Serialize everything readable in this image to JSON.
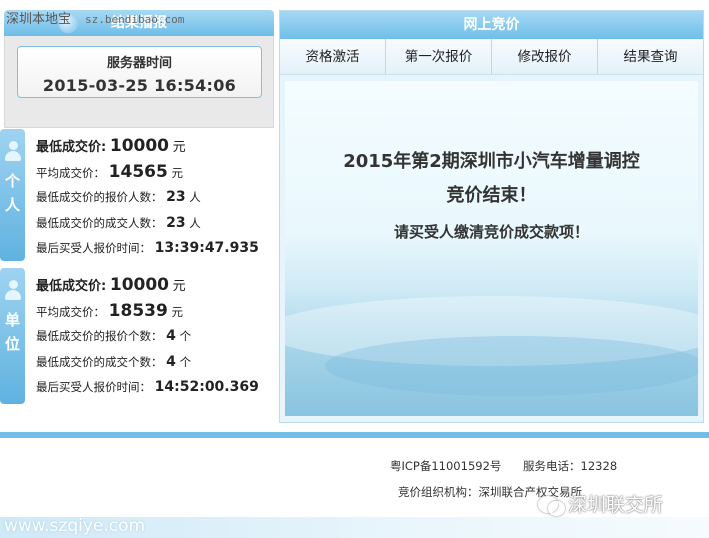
{
  "watermark": {
    "top_text": "深圳本地宝",
    "top_url": "sz.bendibao.com",
    "site": "www.szqiye.com",
    "brand": "深圳联交所"
  },
  "left": {
    "header": "结果播报",
    "server_time_label": "服务器时间",
    "server_time": "2015-03-25 16:54:06",
    "personal": {
      "tag_chars": [
        "个",
        "人"
      ],
      "min_price_label": "最低成交价:",
      "min_price": "10000",
      "unit_yuan": "元",
      "avg_price_label": "平均成交价：",
      "avg_price": "14565",
      "bid_count_label": "最低成交价的报价人数：",
      "bid_count": "23",
      "deal_count_label": "最低成交价的成交人数：",
      "deal_count": "23",
      "count_unit": "人",
      "last_time_label": "最后买受人报价时间：",
      "last_time": "13:39:47.935"
    },
    "company": {
      "tag_chars": [
        "单",
        "位"
      ],
      "min_price_label": "最低成交价:",
      "min_price": "10000",
      "unit_yuan": "元",
      "avg_price_label": "平均成交价：",
      "avg_price": "18539",
      "bid_count_label": "最低成交价的报价个数：",
      "bid_count": "4",
      "deal_count_label": "最低成交价的成交个数：",
      "deal_count": "4",
      "count_unit": "个",
      "last_time_label": "最后买受人报价时间：",
      "last_time": "14:52:00.369"
    }
  },
  "right": {
    "header": "网上竞价",
    "tabs": [
      "资格激活",
      "第一次报价",
      "修改报价",
      "结果查询"
    ],
    "headline1": "2015年第2期深圳市小汽车增量调控",
    "headline2": "竞价结束！",
    "notice": "请买受人缴清竞价成交款项！"
  },
  "footer": {
    "icp": "粤ICP备11001592号",
    "phone": "服务电话：12328",
    "organizer": "竞价组织机构：深圳联合产权交易所"
  }
}
